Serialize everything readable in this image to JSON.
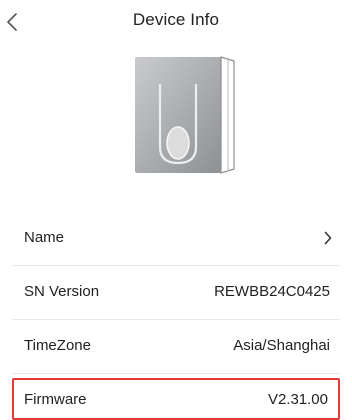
{
  "header": {
    "title": "Device Info",
    "back_icon": "chevron-left-icon"
  },
  "device": {
    "image_icon": "wall-switch-device-image"
  },
  "rows": [
    {
      "label": "Name",
      "value": "",
      "icon": "chevron-right-icon"
    },
    {
      "label": "SN Version",
      "value": "REWBB24C0425"
    },
    {
      "label": "TimeZone",
      "value": "Asia/Shanghai"
    },
    {
      "label": "Firmware",
      "value": "V2.31.00"
    }
  ],
  "colors": {
    "highlight_border": "#e53935",
    "divider": "#e8e8e8",
    "text": "#222222"
  }
}
